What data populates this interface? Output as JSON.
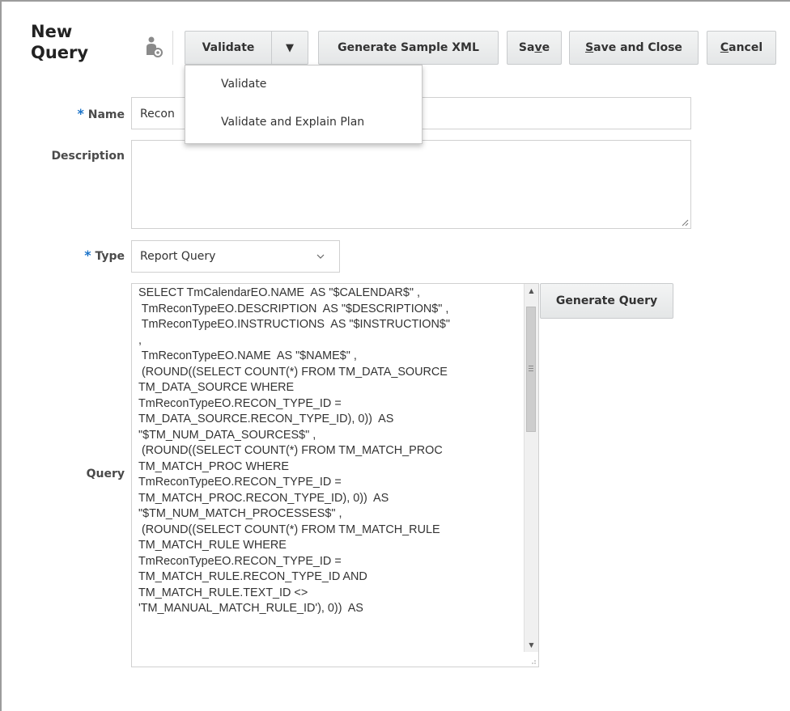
{
  "page": {
    "title": "New Query"
  },
  "toolbar": {
    "validate_label": "Validate",
    "validate_menu_arrow": "▼",
    "generate_xml_label": "Generate Sample XML",
    "save_pre": "Sa",
    "save_mn": "v",
    "save_post": "e",
    "save_close_mn": "S",
    "save_close_post": "ave and Close",
    "cancel_mn": "C",
    "cancel_post": "ancel",
    "query_icon": "user-gear-icon"
  },
  "validate_menu": {
    "items": [
      "Validate",
      "Validate and Explain Plan"
    ]
  },
  "form": {
    "required_marker": "*",
    "name_label": "Name",
    "name_value": "Recon",
    "description_label": "Description",
    "description_value": "",
    "type_label": "Type",
    "type_value": "Report Query",
    "query_label": "Query",
    "generate_query_label": "Generate Query",
    "query_lines": [
      "SELECT TmCalendarEO.NAME  AS \"$CALENDAR$\" ,",
      " TmReconTypeEO.DESCRIPTION  AS \"$DESCRIPTION$\" ,",
      " TmReconTypeEO.INSTRUCTIONS  AS \"$INSTRUCTION$\"",
      ",",
      " TmReconTypeEO.NAME  AS \"$NAME$\" ,",
      " (ROUND((SELECT COUNT(*) FROM TM_DATA_SOURCE",
      "TM_DATA_SOURCE WHERE",
      "TmReconTypeEO.RECON_TYPE_ID =",
      "TM_DATA_SOURCE.RECON_TYPE_ID), 0))  AS",
      "\"$TM_NUM_DATA_SOURCES$\" ,",
      " (ROUND((SELECT COUNT(*) FROM TM_MATCH_PROC",
      "TM_MATCH_PROC WHERE",
      "TmReconTypeEO.RECON_TYPE_ID =",
      "TM_MATCH_PROC.RECON_TYPE_ID), 0))  AS",
      "\"$TM_NUM_MATCH_PROCESSES$\" ,",
      " (ROUND((SELECT COUNT(*) FROM TM_MATCH_RULE",
      "TM_MATCH_RULE WHERE",
      "TmReconTypeEO.RECON_TYPE_ID =",
      "TM_MATCH_RULE.RECON_TYPE_ID AND",
      "TM_MATCH_RULE.TEXT_ID <>",
      "'TM_MANUAL_MATCH_RULE_ID'), 0))  AS"
    ]
  },
  "colors": {
    "required": "#1a73c9",
    "button_border": "#c9cbcd",
    "field_border": "#d0d0d0"
  }
}
